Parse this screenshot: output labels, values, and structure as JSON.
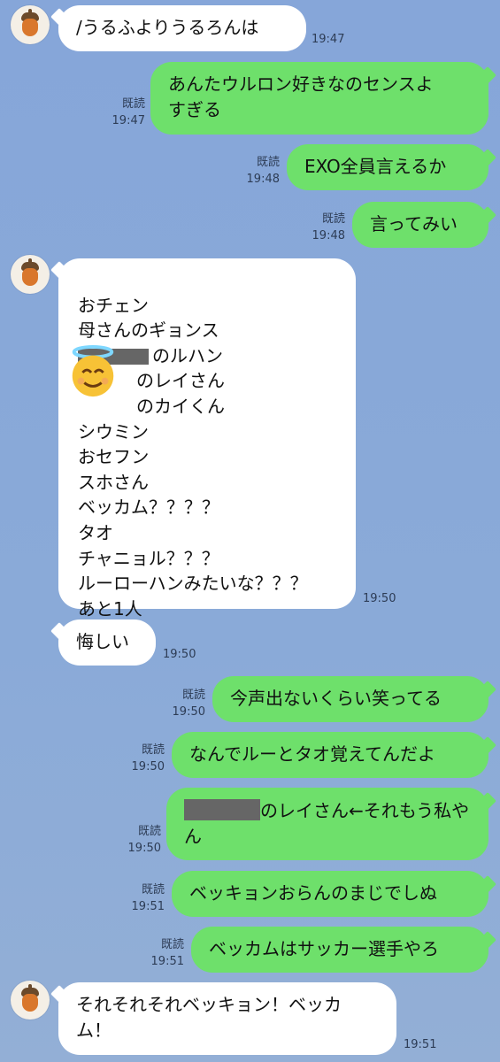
{
  "messages": [
    {
      "text": "/うるふよりうるろんは",
      "time": "19:47"
    },
    {
      "text": "あんたウルロン好きなのセンスよ\nすぎる",
      "read": "既読",
      "time": "19:47"
    },
    {
      "text": "EXO全員言えるか",
      "read": "既読",
      "time": "19:48"
    },
    {
      "text": "言ってみい",
      "read": "既読",
      "time": "19:48"
    },
    {
      "lines": [
        "おチェン",
        "母さんのギョンス",
        "のルハン",
        "のレイさん",
        "のカイくん",
        "シウミン",
        "おセフン",
        "スホさん",
        "ベッカム？？？？",
        "タオ",
        "チャニョル？？？",
        "ルーローハンみたいな？？？",
        "あと1人"
      ],
      "time": "19:50"
    },
    {
      "text": "悔しい",
      "time": "19:50"
    },
    {
      "text": "今声出ないくらい笑ってる",
      "read": "既読",
      "time": "19:50"
    },
    {
      "text": "なんでルーとタオ覚えてんだよ",
      "read": "既読",
      "time": "19:50"
    },
    {
      "text_after_redact": "のレイさん←それもう私や\nん",
      "read": "既読",
      "time": "19:50"
    },
    {
      "text": "ベッキョンおらんのまじでしぬ",
      "read": "既読",
      "time": "19:51"
    },
    {
      "text": "ベッカムはサッカー選手やろ",
      "read": "既読",
      "time": "19:51"
    },
    {
      "text": "それそれそれベッキョン！ベッカ\nム！",
      "time": "19:51"
    }
  ],
  "icons": {
    "avatar": "acorn-icon",
    "emoji": "smiling-face-with-halo-icon"
  },
  "colors": {
    "background": "#8aa8d6",
    "outgoing": "#6ee06b",
    "incoming": "#ffffff"
  }
}
